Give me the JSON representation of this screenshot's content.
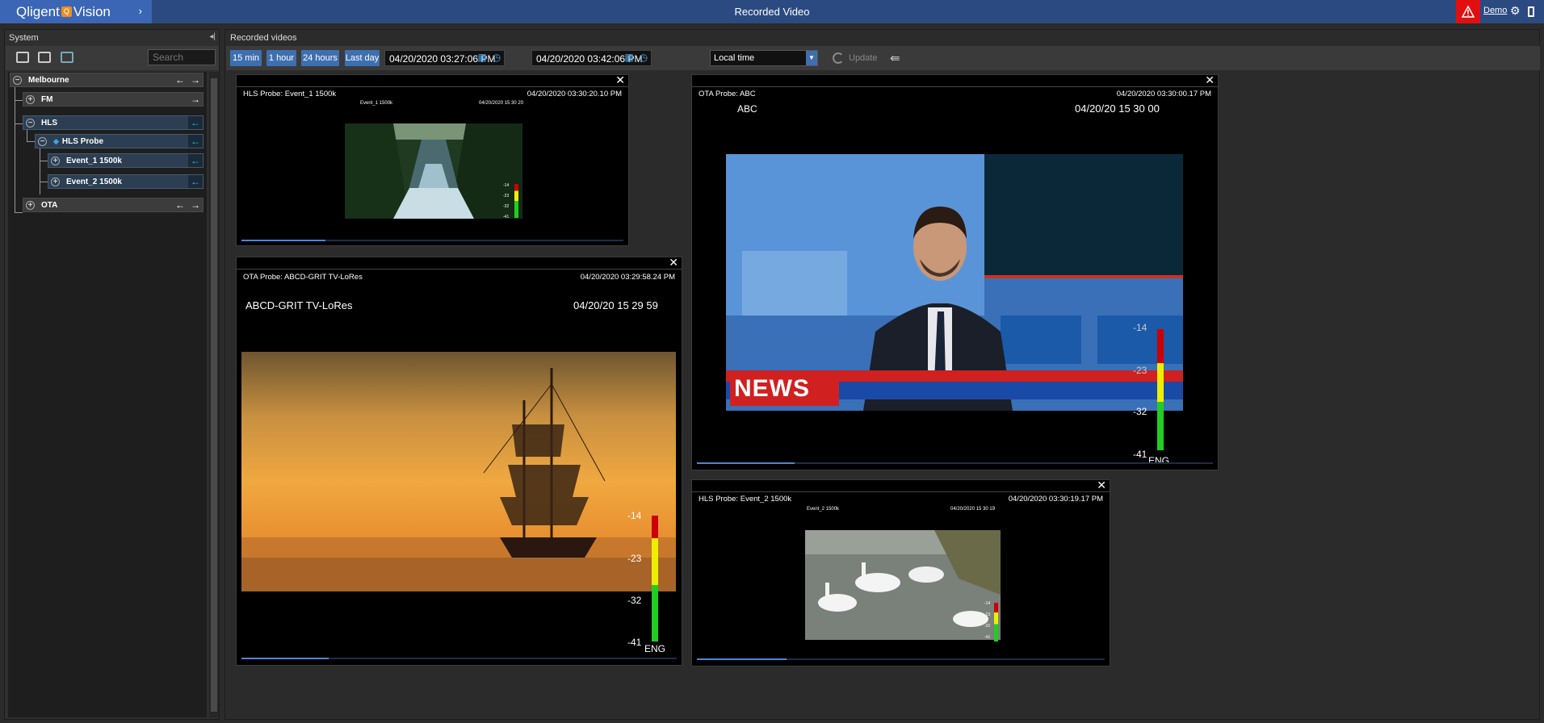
{
  "topbar": {
    "logo_prefix": "Qligent",
    "logo_badge": "Q",
    "logo_name": "Vision",
    "chevron": "›",
    "title": "Recorded Video",
    "user": "Demo",
    "alert_icon": "warning-triangle-icon",
    "alert_color": "#e01010"
  },
  "system": {
    "title": "System",
    "search_placeholder": "Search",
    "tree": [
      {
        "label": "Melbourne",
        "level": 0
      },
      {
        "label": "FM",
        "level": 1
      },
      {
        "label": "HLS",
        "level": 1
      },
      {
        "label": "HLS Probe",
        "level": 2
      },
      {
        "label": "Event_1 1500k",
        "level": 3
      },
      {
        "label": "Event_2 1500k",
        "level": 3
      },
      {
        "label": "OTA",
        "level": 1
      }
    ]
  },
  "recorded": {
    "title": "Recorded videos",
    "quick": [
      "15 min",
      "1 hour",
      "24 hours",
      "Last day"
    ],
    "from": "04/20/2020 03:27:06 PM",
    "to": "04/20/2020 03:42:06 PM",
    "timezone": "Local time",
    "update": "Update"
  },
  "videos": [
    {
      "caption": "HLS Probe: Event_1 1500k",
      "timestamp": "04/20/2020 03:30:20.10 PM",
      "overlay_name": "Event_1 1500k",
      "overlay_time": "04/20/2020 15 30 20",
      "meter_labels": [
        "-14",
        "-23",
        "-32",
        "-41"
      ],
      "lang": "",
      "progress": 0.22
    },
    {
      "caption": "OTA Probe: ABCD-GRIT TV-LoRes",
      "timestamp": "04/20/2020 03:29:58.24 PM",
      "overlay_name": "ABCD-GRIT TV-LoRes",
      "overlay_time": "04/20/20 15 29 59",
      "meter_labels": [
        "-14",
        "-23",
        "-32",
        "-41"
      ],
      "lang": "ENG",
      "progress": 0.2
    },
    {
      "caption": "OTA Probe: ABC",
      "timestamp": "04/20/2020 03:30:00.17 PM",
      "overlay_name": "ABC",
      "overlay_time": "04/20/20 15 30 00",
      "meter_labels": [
        "-14",
        "-23",
        "-32",
        "-41"
      ],
      "lang": "ENG",
      "news": "NEWS",
      "progress": 0.19
    },
    {
      "caption": "HLS Probe: Event_2 1500k",
      "timestamp": "04/20/2020 03:30:19.17 PM",
      "overlay_name": "Event_2 1500k",
      "overlay_time": "04/20/2020 15 30 19",
      "meter_labels": [
        "-14",
        "-23",
        "-32",
        "-41"
      ],
      "lang": "",
      "progress": 0.22
    }
  ]
}
